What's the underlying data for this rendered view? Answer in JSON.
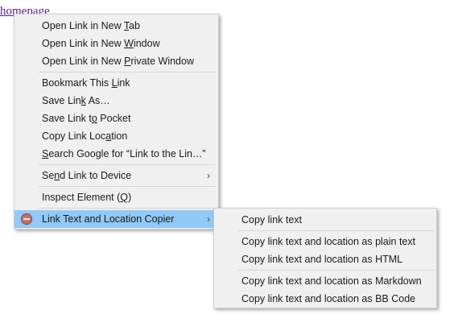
{
  "page": {
    "link_text": "homepage"
  },
  "context_menu": {
    "items": [
      {
        "pre": "Open Link in New ",
        "key": "T",
        "post": "ab"
      },
      {
        "pre": "Open Link in New ",
        "key": "W",
        "post": "indow"
      },
      {
        "pre": "Open Link in New ",
        "key": "P",
        "post": "rivate Window"
      },
      {
        "pre": "Bookmark This ",
        "key": "L",
        "post": "ink"
      },
      {
        "pre": "Save Lin",
        "key": "k",
        "post": " As…"
      },
      {
        "pre": "Save Link t",
        "key": "o",
        "post": " Pocket"
      },
      {
        "pre": "Copy Link Loc",
        "key": "a",
        "post": "tion"
      },
      {
        "pre": "",
        "key": "S",
        "post": "earch Google for “Link to the Lin…”"
      },
      {
        "pre": "Se",
        "key": "n",
        "post": "d Link to Device"
      },
      {
        "pre": "Inspect Element (",
        "key": "Q",
        "post": ")"
      },
      {
        "pre": "Link Text and Location Copier",
        "key": "",
        "post": ""
      }
    ],
    "submenu_arrow": "›"
  },
  "submenu": {
    "items": [
      {
        "label": "Copy link text"
      },
      {
        "label": "Copy link text and location as plain text"
      },
      {
        "label": "Copy link text and location as HTML"
      },
      {
        "label": "Copy link text and location as Markdown"
      },
      {
        "label": "Copy link text and location as BB Code"
      }
    ]
  },
  "colors": {
    "menu_bg": "#f0f0f0",
    "highlight": "#91c9f7",
    "link": "#551a8b",
    "extension_icon": "#c0726e"
  }
}
